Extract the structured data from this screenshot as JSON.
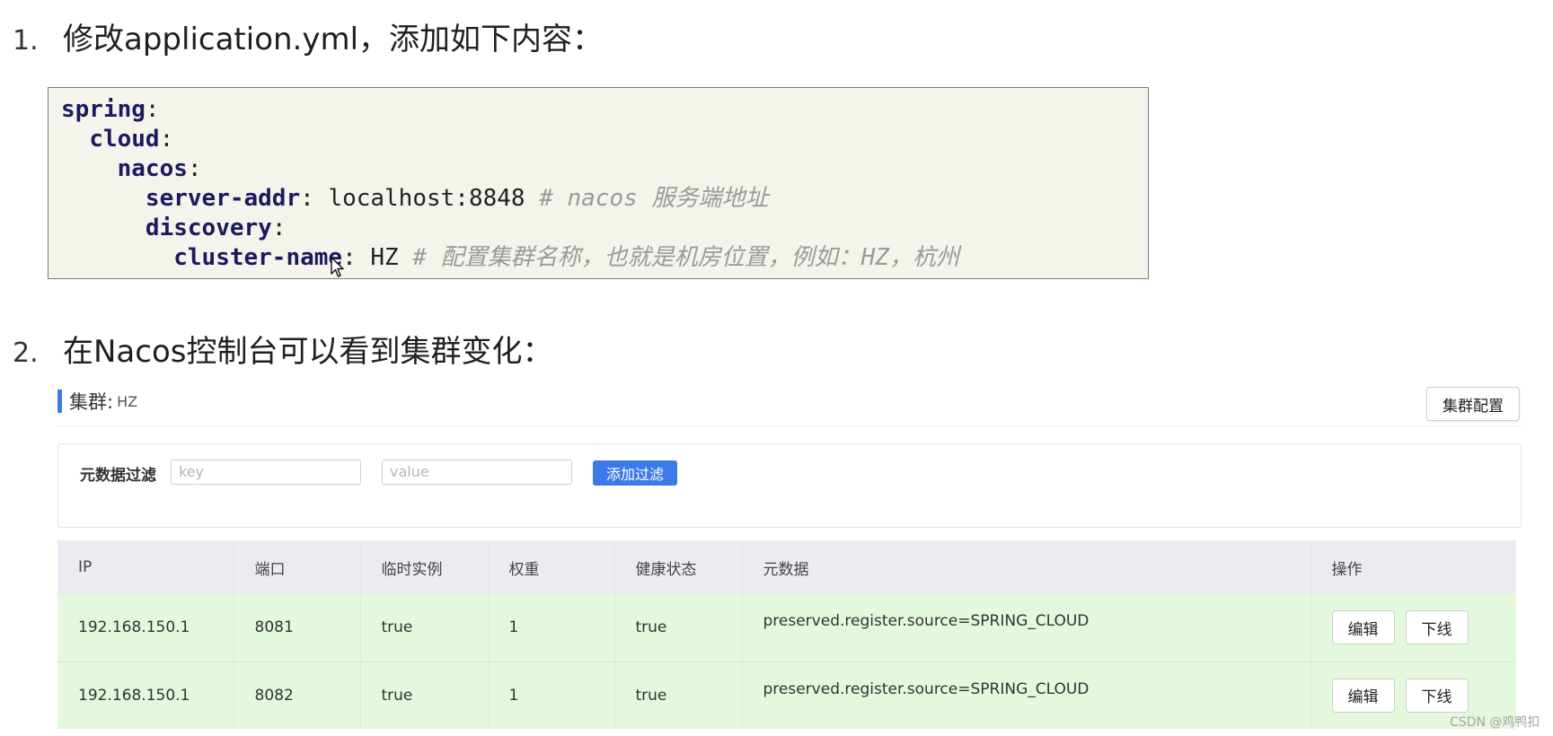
{
  "step1": {
    "number": "1.",
    "text": "修改application.yml，添加如下内容："
  },
  "code_lines": [
    {
      "key": "spring",
      "sep": ":",
      "rest": "",
      "comment": ""
    },
    {
      "key": "cloud",
      "sep": ":",
      "rest": "",
      "comment": ""
    },
    {
      "key": "nacos",
      "sep": ":",
      "rest": "",
      "comment": ""
    },
    {
      "key": "server-addr",
      "sep": ":",
      "rest": " localhost:8848 ",
      "comment": "# nacos 服务端地址"
    },
    {
      "key": "discovery",
      "sep": ":",
      "rest": "",
      "comment": ""
    },
    {
      "key": "cluster-name",
      "sep": ":",
      "rest": " HZ ",
      "comment": "# 配置集群名称，也就是机房位置，例如：HZ，杭州"
    }
  ],
  "step2": {
    "number": "2.",
    "text": "在Nacos控制台可以看到集群变化："
  },
  "cluster": {
    "label": "集群:",
    "value": "HZ",
    "config_button": "集群配置"
  },
  "filter": {
    "label": "元数据过滤",
    "key_placeholder": "key",
    "value_placeholder": "value",
    "add_button": "添加过滤"
  },
  "table": {
    "headers": [
      "IP",
      "端口",
      "临时实例",
      "权重",
      "健康状态",
      "元数据",
      "操作"
    ],
    "rows": [
      {
        "ip": "192.168.150.1",
        "port": "8081",
        "ephemeral": "true",
        "weight": "1",
        "healthy": "true",
        "metadata": "preserved.register.source=SPRING_CLOUD",
        "edit": "编辑",
        "offline": "下线"
      },
      {
        "ip": "192.168.150.1",
        "port": "8082",
        "ephemeral": "true",
        "weight": "1",
        "healthy": "true",
        "metadata": "preserved.register.source=SPRING_CLOUD",
        "edit": "编辑",
        "offline": "下线"
      }
    ]
  },
  "watermark": "CSDN @鸡鸭扣",
  "colors": {
    "accent": "#3c7ae8",
    "row_bg": "#e4f8de",
    "header_bg": "#ebecf2",
    "code_bg": "#f4f4ec",
    "code_key": "#1c1a5e",
    "code_comment": "#9a9a9a"
  }
}
